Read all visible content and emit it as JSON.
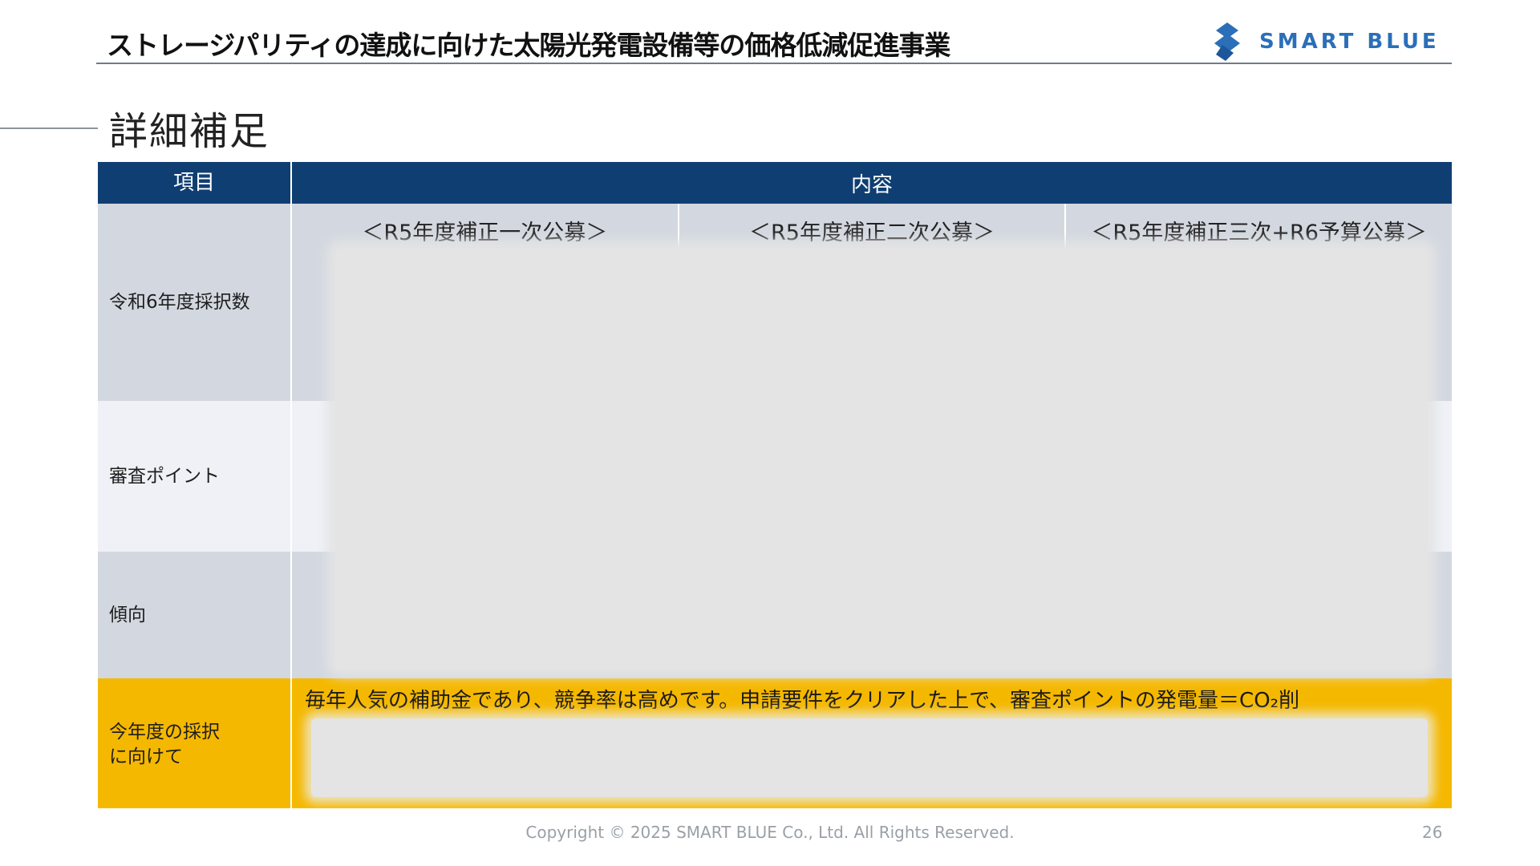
{
  "header": {
    "title": "ストレージパリティの達成に向けた太陽光発電設備等の価格低減促進事業",
    "logo_text": "SMART BLUE",
    "logo_icon": "diamond-stack-logo-icon",
    "accent_color": "#2a6fb8"
  },
  "section": {
    "title": "詳細補足"
  },
  "table": {
    "header": {
      "item": "項目",
      "content": "内容"
    },
    "header_color": "#0f3e72",
    "rows": {
      "adoption": {
        "label": "令和6年度採択数",
        "columns": [
          {
            "title": "＜R5年度補正一次公募＞"
          },
          {
            "title": "＜R5年度補正二次公募＞"
          },
          {
            "title": "＜R5年度補正三次+R6予算公募＞"
          }
        ]
      },
      "review": {
        "label": "審査ポイント"
      },
      "trend": {
        "label": "傾向"
      },
      "this_year": {
        "label_line1": "今年度の採択",
        "label_line2": "に向けて",
        "text": "毎年人気の補助金であり、競争率は高めです。申請要件をクリアした上で、審査ポイントの発電量＝CO₂削",
        "highlight_color": "#f5b800"
      }
    }
  },
  "footer": {
    "copyright": "Copyright © 2025 SMART BLUE Co., Ltd. All Rights Reserved.",
    "page_number": "26"
  }
}
